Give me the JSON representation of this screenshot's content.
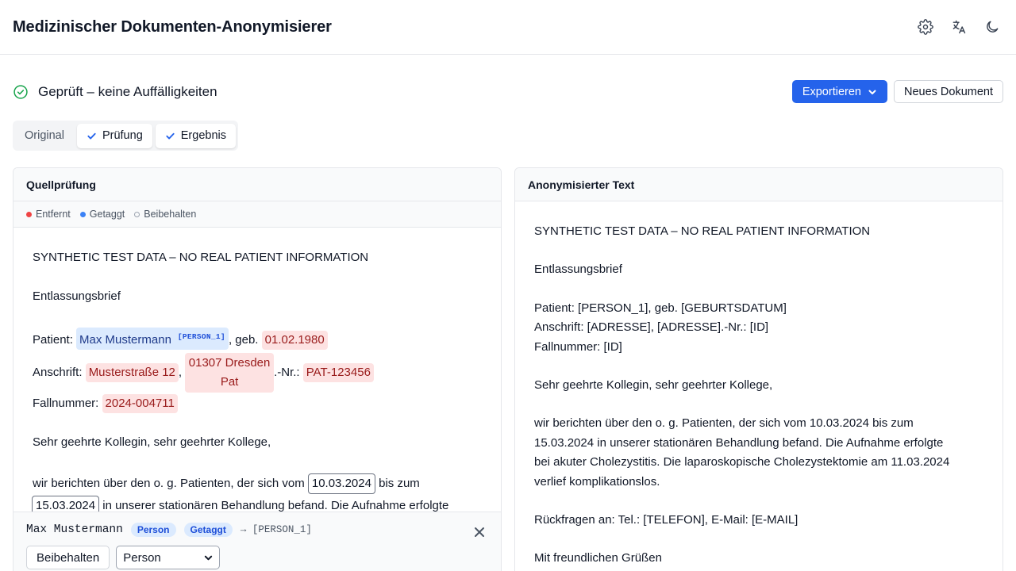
{
  "app": {
    "title": "Medizinischer Dokumenten-Anonymisierer"
  },
  "header_icons": [
    "gear-icon",
    "translate-icon",
    "moon-icon"
  ],
  "status": {
    "text": "Geprüft – keine Auffälligkeiten",
    "icon": "check-circle-icon",
    "color": "#16a34a"
  },
  "actions": {
    "export_label": "Exportieren",
    "new_doc_label": "Neues Dokument",
    "accent": "#2563eb"
  },
  "tabs": [
    {
      "label": "Original",
      "checked": false
    },
    {
      "label": "Prüfung",
      "checked": true
    },
    {
      "label": "Ergebnis",
      "checked": true
    }
  ],
  "left_panel": {
    "title": "Quellprüfung",
    "legend": {
      "removed": "Entfernt",
      "tagged": "Getaggt",
      "kept": "Beibehalten"
    },
    "doc": {
      "line1": "SYNTHETIC TEST DATA – NO REAL PATIENT INFORMATION",
      "line2": "Entlassungsbrief",
      "patient_prefix": "Patient: ",
      "patient_name": "Max Mustermann",
      "patient_tag": "[PERSON_1]",
      "geb_text": ", geb. ",
      "dob": "01.02.1980",
      "anschrift_prefix": "Anschrift: ",
      "street": "Musterstraße 12",
      "comma": ",",
      "city_line1": "01307 Dresden",
      "city_line2": "Pat",
      "nr_text": ".-Nr.: ",
      "pat_id": "PAT-123456",
      "fall_prefix": "Fallnummer: ",
      "fall_id": "2024-004711",
      "greeting": "Sehr geehrte Kollegin, sehr geehrter Kollege,",
      "p1_a": "wir berichten über den o. g. Patienten, der sich vom ",
      "date_from": "10.03.2024",
      "p1_b": " bis zum",
      "date_to": "15.03.2024",
      "p1_c": " in unserer stationären Behandlung befand. Die Aufnahme erfolgte"
    },
    "editor": {
      "entity": "Max Mustermann",
      "type_badge": "Person",
      "status_badge": "Getaggt",
      "arrow": "→ [PERSON_1]",
      "keep_label": "Beibehalten",
      "select_value": "Person"
    }
  },
  "right_panel": {
    "title": "Anonymisierter Text",
    "lines": {
      "l1": "SYNTHETIC TEST DATA – NO REAL PATIENT INFORMATION",
      "l2": "Entlassungsbrief",
      "l3": "Patient: [PERSON_1], geb. [GEBURTSDATUM]",
      "l4": "Anschrift: [ADRESSE], [ADRESSE].-Nr.: [ID]",
      "l5": "Fallnummer: [ID]",
      "l6": "Sehr geehrte Kollegin, sehr geehrter Kollege,",
      "l7": "wir berichten über den o. g. Patienten, der sich vom 10.03.2024 bis zum",
      "l8": "15.03.2024 in unserer stationären Behandlung befand. Die Aufnahme erfolgte",
      "l9": "bei akuter Cholezystitis. Die laparoskopische Cholezystektomie am 11.03.2024",
      "l10": "verlief komplikationslos.",
      "l11": "Rückfragen an: Tel.: [TELEFON], E-Mail: [E-MAIL]",
      "l12": "Mit freundlichen Grüßen"
    }
  }
}
